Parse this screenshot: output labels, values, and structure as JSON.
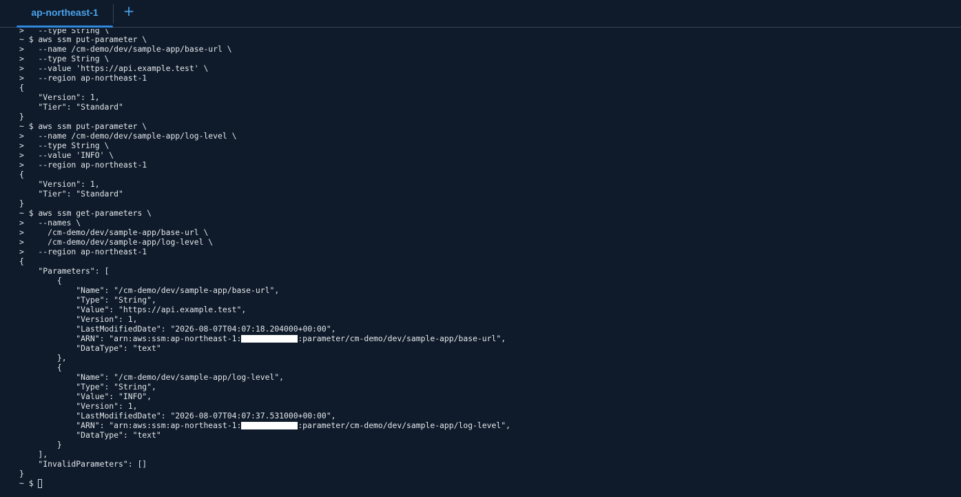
{
  "tabs": {
    "active": "ap-northeast-1",
    "add_label": "+"
  },
  "terminal": {
    "lines": {
      "l0": ">   --type String \\",
      "l1": "~ $ aws ssm put-parameter \\",
      "l2": ">   --name /cm-demo/dev/sample-app/base-url \\",
      "l3": ">   --type String \\",
      "l4": ">   --value 'https://api.example.test' \\",
      "l5": ">   --region ap-northeast-1",
      "l6": "{",
      "l7": "    \"Version\": 1,",
      "l8": "    \"Tier\": \"Standard\"",
      "l9": "}",
      "l10": "~ $ aws ssm put-parameter \\",
      "l11": ">   --name /cm-demo/dev/sample-app/log-level \\",
      "l12": ">   --type String \\",
      "l13": ">   --value 'INFO' \\",
      "l14": ">   --region ap-northeast-1",
      "l15": "{",
      "l16": "    \"Version\": 1,",
      "l17": "    \"Tier\": \"Standard\"",
      "l18": "}",
      "l19": "~ $ aws ssm get-parameters \\",
      "l20": ">   --names \\",
      "l21": ">     /cm-demo/dev/sample-app/base-url \\",
      "l22": ">     /cm-demo/dev/sample-app/log-level \\",
      "l23": ">   --region ap-northeast-1",
      "l24": "{",
      "l25": "    \"Parameters\": [",
      "l26": "        {",
      "l27": "            \"Name\": \"/cm-demo/dev/sample-app/base-url\",",
      "l28": "            \"Type\": \"String\",",
      "l29": "            \"Value\": \"https://api.example.test\",",
      "l30": "            \"Version\": 1,",
      "l31": "            \"LastModifiedDate\": \"2026-08-07T04:07:18.204000+00:00\",",
      "l32a": "            \"ARN\": \"arn:aws:ssm:ap-northeast-1:",
      "l32b": ":parameter/cm-demo/dev/sample-app/base-url\",",
      "l33": "            \"DataType\": \"text\"",
      "l34": "        },",
      "l35": "        {",
      "l36": "            \"Name\": \"/cm-demo/dev/sample-app/log-level\",",
      "l37": "            \"Type\": \"String\",",
      "l38": "            \"Value\": \"INFO\",",
      "l39": "            \"Version\": 1,",
      "l40": "            \"LastModifiedDate\": \"2026-08-07T04:07:37.531000+00:00\",",
      "l41a": "            \"ARN\": \"arn:aws:ssm:ap-northeast-1:",
      "l41b": ":parameter/cm-demo/dev/sample-app/log-level\",",
      "l42": "            \"DataType\": \"text\"",
      "l43": "        }",
      "l44": "    ],",
      "l45": "    \"InvalidParameters\": []",
      "l46": "}",
      "l47": "~ $ "
    }
  }
}
